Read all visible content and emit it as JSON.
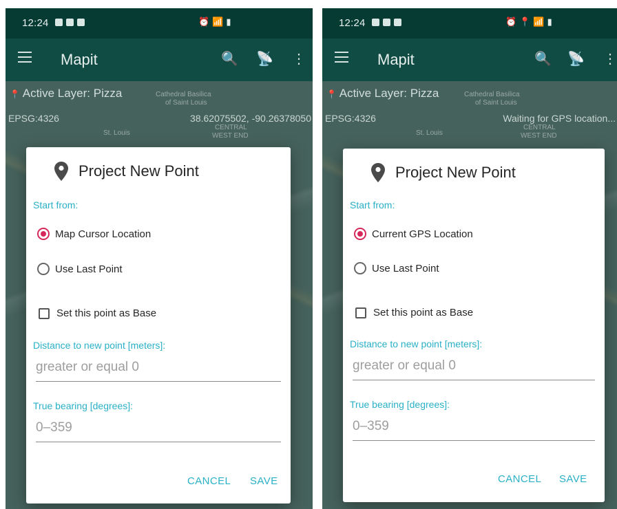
{
  "colors": {
    "accent": "#2ab0c7",
    "radio_selected": "#d6285a",
    "appbar": "#104c43",
    "statusbar": "#063b34"
  },
  "screens": [
    {
      "status_time": "12:24",
      "app_title": "Mapit",
      "active_layer": "Active Layer: Pizza",
      "epsg": "EPSG:4326",
      "gps_text": "38.62075502, -90.26378050",
      "map_labels": [
        "Cathedral Basilica",
        "of Saint Louis",
        "St. Louis",
        "CENTRAL",
        "WEST END"
      ],
      "dialog": {
        "title": "Project New Point",
        "start_from_label": "Start from:",
        "option1": "Map Cursor Location",
        "option2": "Use Last Point",
        "base_checkbox": "Set this point as Base",
        "distance_label": "Distance to new point [meters]:",
        "distance_placeholder": "greater or equal 0",
        "bearing_label": "True bearing [degrees]:",
        "bearing_placeholder": "0–359",
        "cancel": "CANCEL",
        "save": "SAVE"
      }
    },
    {
      "status_time": "12:24",
      "app_title": "Mapit",
      "active_layer": "Active Layer: Pizza",
      "epsg": "EPSG:4326",
      "gps_text": "Waiting for GPS location...",
      "map_labels": [
        "Cathedral Basilica",
        "of Saint Louis",
        "St. Louis",
        "CENTRAL",
        "WEST END"
      ],
      "dialog": {
        "title": "Project New Point",
        "start_from_label": "Start from:",
        "option1": "Current GPS Location",
        "option2": "Use Last Point",
        "base_checkbox": "Set this point as Base",
        "distance_label": "Distance to new point [meters]:",
        "distance_placeholder": "greater or equal 0",
        "bearing_label": "True bearing [degrees]:",
        "bearing_placeholder": "0–359",
        "cancel": "CANCEL",
        "save": "SAVE"
      }
    }
  ]
}
